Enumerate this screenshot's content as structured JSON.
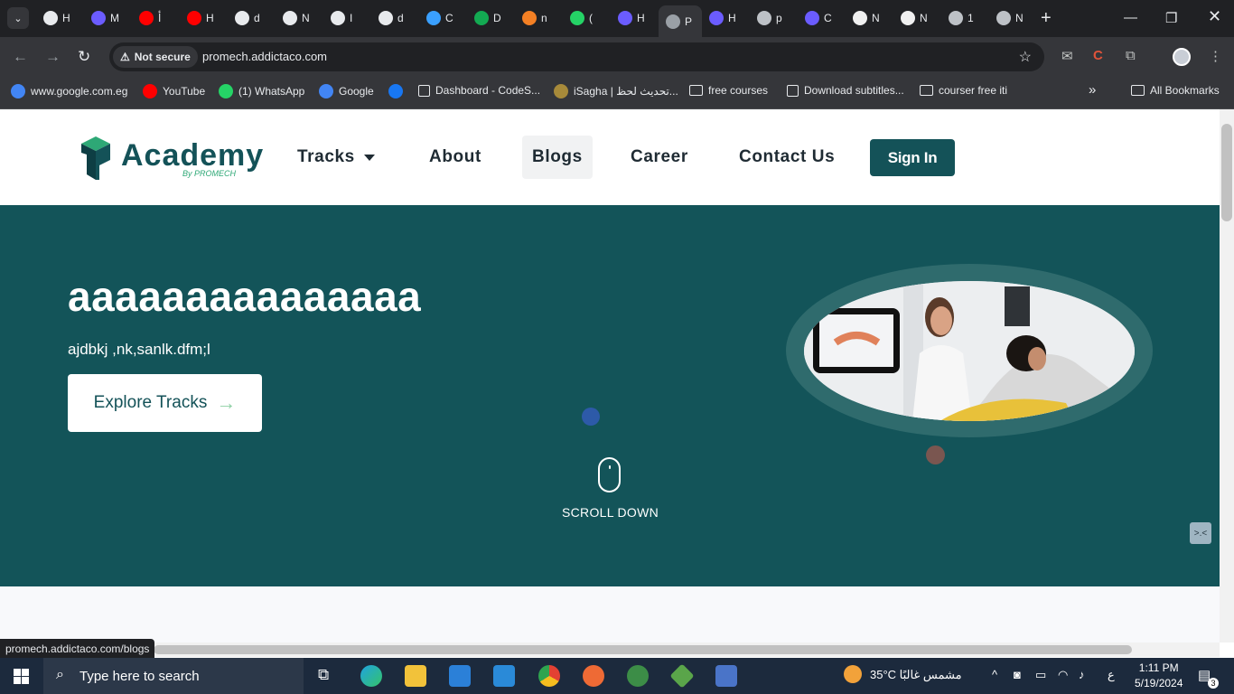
{
  "browser": {
    "tabs": [
      {
        "label": "H",
        "icon": "openai-icon"
      },
      {
        "label": "M",
        "icon": "app-icon"
      },
      {
        "label": "أ",
        "icon": "youtube-icon"
      },
      {
        "label": "H",
        "icon": "youtube-icon"
      },
      {
        "label": "d",
        "icon": "openai-icon"
      },
      {
        "label": "N",
        "icon": "openai-icon"
      },
      {
        "label": "I",
        "icon": "openai-icon"
      },
      {
        "label": "d",
        "icon": "openai-icon"
      },
      {
        "label": "C",
        "icon": "copilot-icon"
      },
      {
        "label": "D",
        "icon": "mongodb-icon"
      },
      {
        "label": "n",
        "icon": "stackoverflow-icon"
      },
      {
        "label": "(",
        "icon": "whatsapp-icon"
      },
      {
        "label": "H",
        "icon": "app-icon"
      },
      {
        "label": "P",
        "icon": "page-icon",
        "active": true
      },
      {
        "label": "H",
        "icon": "app-icon"
      },
      {
        "label": "p",
        "icon": "globe-icon"
      },
      {
        "label": "C",
        "icon": "app-icon"
      },
      {
        "label": "N",
        "icon": "github-icon"
      },
      {
        "label": "N",
        "icon": "github-icon"
      },
      {
        "label": "1",
        "icon": "globe-icon"
      },
      {
        "label": "N",
        "icon": "globe-icon"
      }
    ],
    "security_label": "Not secure",
    "url": "promech.addictaco.com",
    "bookmarks": [
      {
        "label": "www.google.com.eg",
        "icon": "google-icon"
      },
      {
        "label": "YouTube",
        "icon": "youtube-icon"
      },
      {
        "label": "(1) WhatsApp",
        "icon": "whatsapp-icon"
      },
      {
        "label": "Google",
        "icon": "google-icon"
      },
      {
        "label": "",
        "icon": "facebook-icon"
      },
      {
        "label": "Dashboard - CodeS...",
        "icon": "page-icon"
      },
      {
        "label": "iSagha | تحديث لحظ...",
        "icon": "isagha-icon"
      },
      {
        "label": "free courses",
        "icon": "folder-icon"
      },
      {
        "label": "Download subtitles...",
        "icon": "page-icon"
      },
      {
        "label": "courser free iti",
        "icon": "folder-icon"
      }
    ],
    "all_bookmarks": "All Bookmarks",
    "status_url": "promech.addictaco.com/blogs"
  },
  "site": {
    "logo_word": "Academy",
    "logo_sub": "By PROMECH",
    "nav": {
      "tracks": "Tracks",
      "about": "About",
      "blogs": "Blogs",
      "career": "Career",
      "contact": "Contact Us"
    },
    "signin": "Sign In",
    "hero": {
      "title": "aaaaaaaaaaaaaaa",
      "subtitle": "ajdbkj ,nk,sanlk.dfm;l",
      "cta": "Explore Tracks",
      "scroll": "SCROLL DOWN"
    }
  },
  "taskbar": {
    "search_placeholder": "Type here to search",
    "weather": "35°C  مشمس غالبًا",
    "lang": "ع",
    "time": "1:11 PM",
    "date": "5/19/2024",
    "notifications": "3"
  },
  "colors": {
    "brand": "#145258",
    "hero_bg": "#135459",
    "accent_green": "#2ea876"
  }
}
